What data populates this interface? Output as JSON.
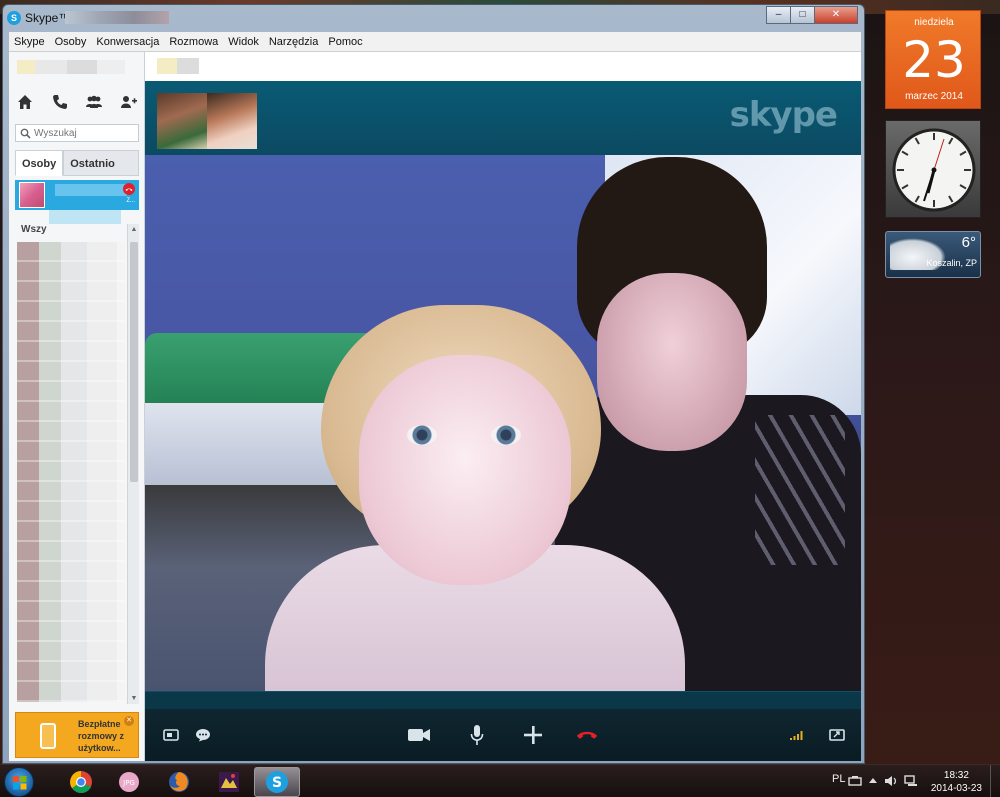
{
  "window": {
    "title": "Skype™ -",
    "minimize": "‒",
    "maximize": "□",
    "close": "✕"
  },
  "menu": [
    "Skype",
    "Osoby",
    "Konwersacja",
    "Rozmowa",
    "Widok",
    "Narzędzia",
    "Pomoc"
  ],
  "sidebar": {
    "search_placeholder": "Wyszukaj",
    "tabs": [
      "Osoby",
      "Ostatnio"
    ],
    "section_label": "Wszy",
    "contact_subtext": "Z...",
    "promo_text": "Bezpłatne rozmowy z użytkow..."
  },
  "main": {
    "skype_logo": "skype"
  },
  "gadgets": {
    "calendar": {
      "weekday": "niedziela",
      "day": "23",
      "month": "marzec 2014"
    },
    "weather": {
      "temp": "6°",
      "location": "Koszalin, ZP"
    }
  },
  "taskbar": {
    "lang": "PL",
    "time": "18:32",
    "date": "2014-03-23"
  },
  "colors": {
    "skype_blue": "#2aa8e0",
    "call_bar": "#0b4a62",
    "hangup_red": "#e0202a",
    "promo_orange": "#f4a820",
    "calendar_orange": "#f07a2a"
  },
  "icons": {
    "nav": [
      "home-icon",
      "phone-icon",
      "contacts-icon",
      "add-contact-icon"
    ],
    "call_controls": [
      "screen-share-icon",
      "chat-icon",
      "video-icon",
      "microphone-icon",
      "add-icon",
      "hangup-icon",
      "signal-icon",
      "fullscreen-icon"
    ]
  }
}
